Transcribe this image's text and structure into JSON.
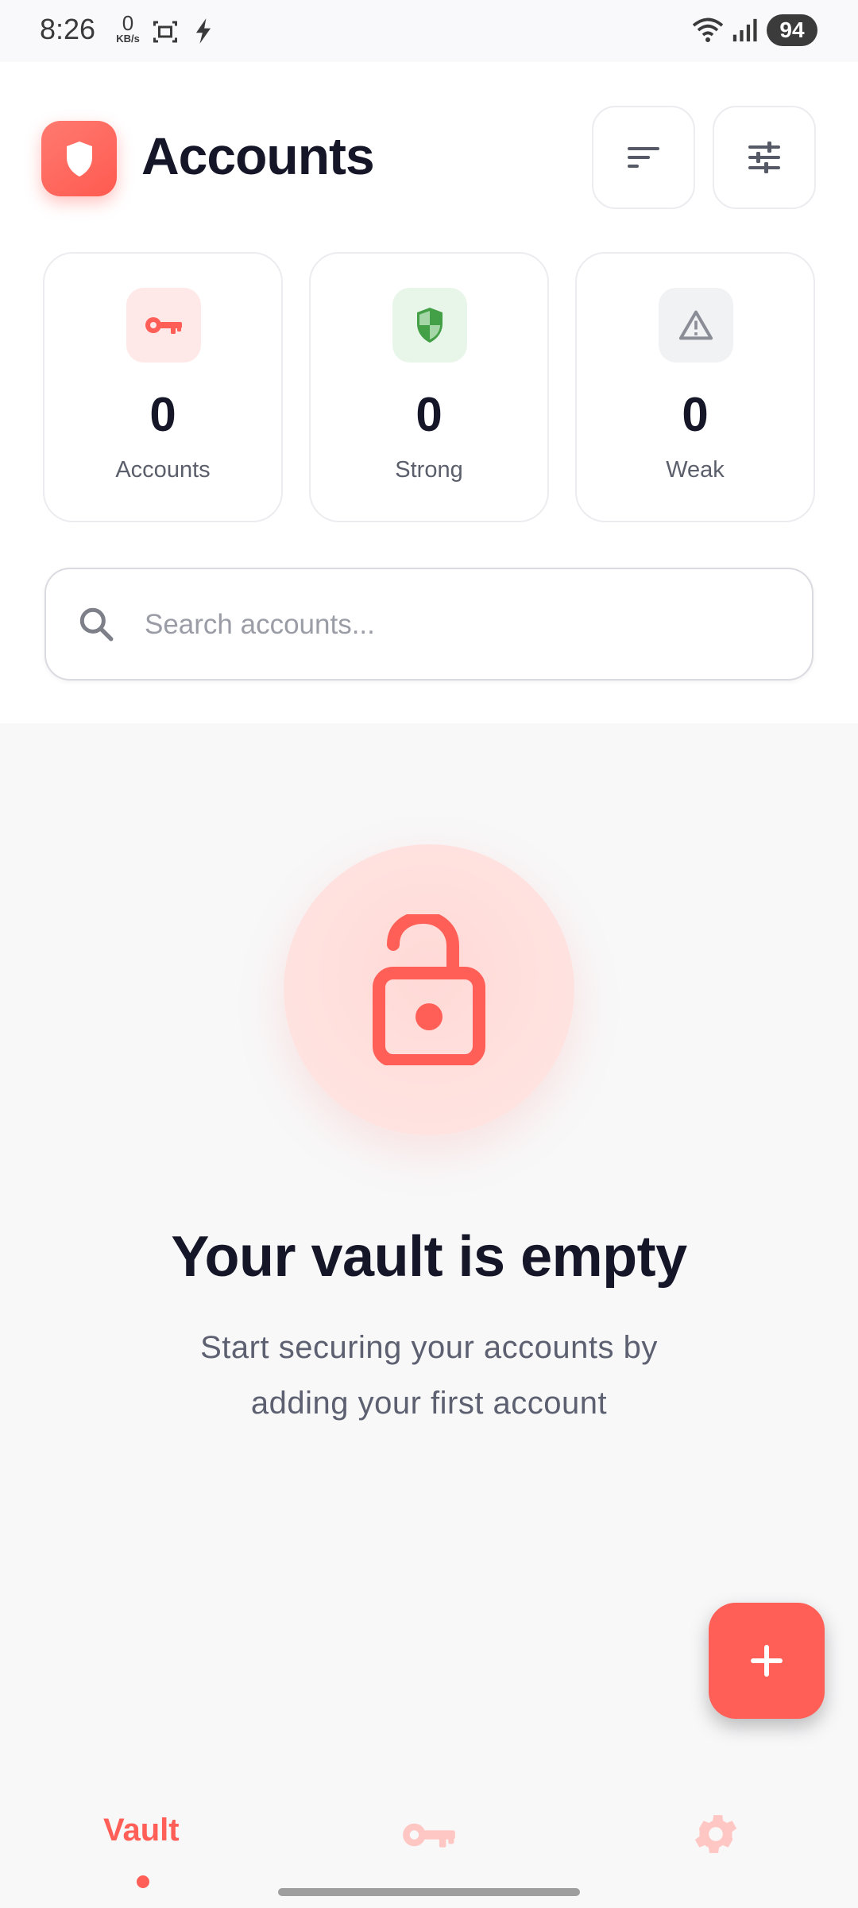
{
  "status_bar": {
    "time": "8:26",
    "net_speed_value": "0",
    "net_speed_unit": "KB/s",
    "battery": "94"
  },
  "header": {
    "title": "Accounts"
  },
  "stats": [
    {
      "value": "0",
      "label": "Accounts",
      "icon": "key-icon",
      "color": "#ff5f57"
    },
    {
      "value": "0",
      "label": "Strong",
      "icon": "shield-check-icon",
      "color": "#43a047"
    },
    {
      "value": "0",
      "label": "Weak",
      "icon": "warning-icon",
      "color": "#8a8d96"
    }
  ],
  "search": {
    "placeholder": "Search accounts..."
  },
  "empty_state": {
    "title": "Your vault is empty",
    "subtitle": "Start securing your accounts by adding your first account"
  },
  "bottom_nav": {
    "vault_label": "Vault"
  },
  "colors": {
    "accent": "#ff5f57",
    "text_dark": "#161629",
    "green": "#43a047"
  }
}
